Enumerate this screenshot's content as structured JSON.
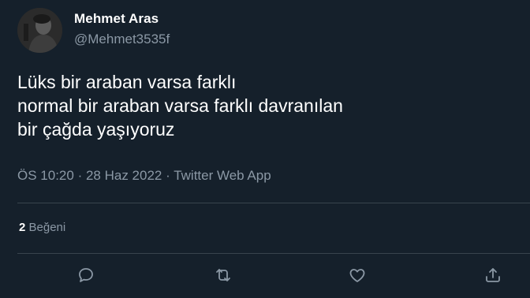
{
  "user": {
    "name": "Mehmet Aras",
    "handle": "@Mehmet3535f"
  },
  "tweet": {
    "lines": [
      "Lüks bir araban varsa farklı",
      "normal bir araban varsa farklı davranılan",
      "bir çağda yaşıyoruz"
    ],
    "time": "ÖS 10:20",
    "date": "28 Haz 2022",
    "source": "Twitter Web App",
    "separator": "·"
  },
  "stats": {
    "likes_count": "2",
    "likes_label": "Beğeni"
  },
  "actions": {
    "icons": [
      "reply-icon",
      "retweet-icon",
      "like-icon",
      "share-icon"
    ]
  },
  "colors": {
    "background": "#15202b",
    "text_primary": "#ffffff",
    "text_secondary": "#8b98a5",
    "divider": "#38444d"
  }
}
